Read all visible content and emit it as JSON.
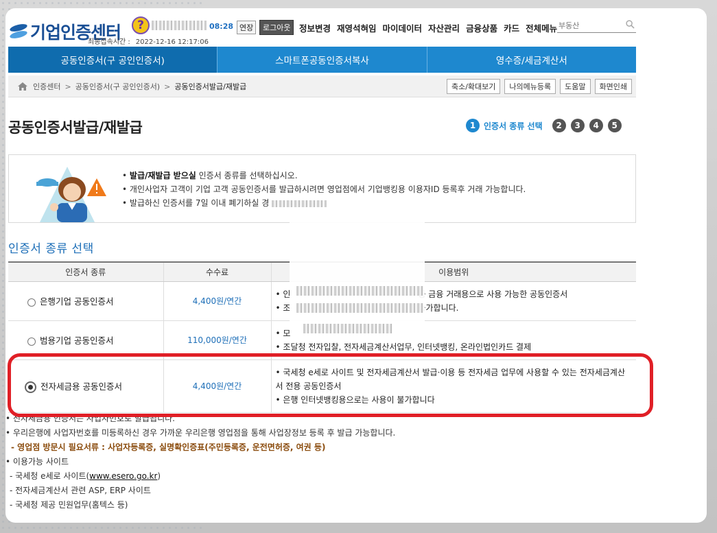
{
  "header": {
    "logo_text": "기업인증센터",
    "timer": "08:28",
    "extend_label": "연장",
    "logout_label": "로그아웃",
    "last_login_label": "최종접속시간 :",
    "last_login_time": "2022-12-16 12:17:06",
    "menu": [
      "정보변경",
      "재영석혀임",
      "마이데이터",
      "자산관리",
      "금융상품",
      "카드",
      "전체메뉴"
    ],
    "search_placeholder": "부동산"
  },
  "nav": [
    {
      "label": "공동인증서(구 공인인증서)",
      "active": true
    },
    {
      "label": "스마트폰공동인증서복사",
      "active": false
    },
    {
      "label": "영수증/세금계산서",
      "active": false
    }
  ],
  "breadcrumb": [
    "인증센터",
    "공동인증서(구 공인인증서)",
    "공동인증서발급/재발급"
  ],
  "util_buttons": [
    "축소/확대보기",
    "나의메뉴등록",
    "도움말",
    "화면인쇄"
  ],
  "page_title": "공동인증서발급/재발급",
  "steps": {
    "current": "1",
    "current_label": "인증서 종류 선택",
    "others": [
      "2",
      "3",
      "4",
      "5"
    ]
  },
  "notice": {
    "line1_bold": "발급/재발급 받으실",
    "line1_rest": " 인증서 종류를 선택하십시오.",
    "line2": "개인사업자 고객이 기업 고객 공동인증서를 발급하시려면 영업점에서 기업뱅킹용 이용자ID 등록후 거래 가능합니다.",
    "line3": "발급하신 인증서를 7일 이내 폐기하실 경"
  },
  "section_title": "인증서 종류 선택",
  "table": {
    "headers": [
      "인증서 종류",
      "수수료",
      "이용범위"
    ],
    "rows": [
      {
        "type": "은행기업 공동인증서",
        "fee": "4,400원/연간",
        "checked": false,
        "usage": [
          "인",
          "조"
        ],
        "usage_tail": [
          "등 금융 거래용으로 사용 가능한 공동인증서",
          "능가합니다."
        ]
      },
      {
        "type": "범용기업 공동인증서",
        "fee": "110,000원/연간",
        "checked": false,
        "usage": [
          "모",
          "조달청 전자입찰, 전자세금계산서업무, 인터넷뱅킹, 온라인법인카드 결제"
        ],
        "usage_tail": [
          "",
          ""
        ]
      },
      {
        "type": "전자세금용 공동인증서",
        "fee": "4,400원/연간",
        "checked": true,
        "usage": [
          "국세청 e세로 사이트 및 전자세금계산서 발급·이용 등 전자세금 업무에 사용할 수 있는 전자세금계산서 전용 공동인증서",
          "은행 인터넷뱅킹용으로는 사용이 불가합니다"
        ],
        "usage_tail": [
          "",
          ""
        ]
      }
    ]
  },
  "notes": {
    "n1": "전자세금용 인증서는 사업자번호로 발급됩니다.",
    "n2": "우리은행에 사업자번호를 미등록하신 경우 가까운 우리은행 영업점을 통해 사업장정보 등록 후 발급 가능합니다.",
    "docs": "- 영업점 방문시 필요서류 : 사업자등록증, 실명확인증표(주민등록증, 운전면허증, 여권 등)",
    "sites_title": "이용가능 사이트",
    "site1_prefix": "국세청 e세로 사이트(",
    "site1_link": "www.esero.go.kr",
    "site1_suffix": ")",
    "site2": "전자세금계산서 관련 ASP, ERP 사이트",
    "site3": "국세청 제공 민원업무(홈텍스 등)"
  }
}
